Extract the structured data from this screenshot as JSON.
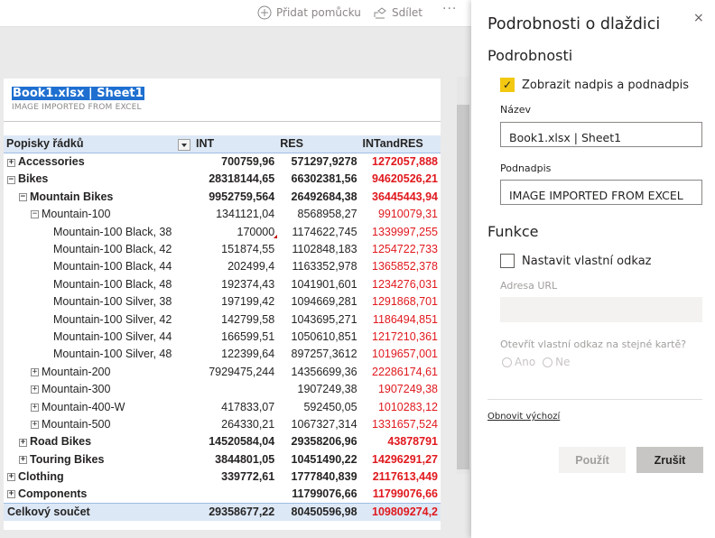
{
  "toolbar": {
    "add_widget": "Přidat pomůcku",
    "share": "Sdílet",
    "more": "···"
  },
  "tile": {
    "title": "Book1.xlsx | Sheet1",
    "subtitle": "IMAGE IMPORTED FROM EXCEL"
  },
  "pivot": {
    "headers": [
      "Popisky řádků",
      "INT",
      "RES",
      "INTandRES"
    ],
    "rows": [
      {
        "label": "Accessories",
        "int": "700759,96",
        "res": "571297,9278",
        "intres": "1272057,888"
      },
      {
        "label": "Bikes",
        "int": "28318144,65",
        "res": "66302381,56",
        "intres": "94620526,21"
      },
      {
        "label": "Mountain Bikes",
        "int": "9952759,564",
        "res": "26492684,38",
        "intres": "36445443,94"
      },
      {
        "label": "Mountain-100",
        "int": "1341121,04",
        "res": "8568958,27",
        "intres": "9910079,31"
      },
      {
        "label": "Mountain-100 Black, 38",
        "int": "170000",
        "res": "1174622,745",
        "intres": "1339997,255"
      },
      {
        "label": "Mountain-100 Black, 42",
        "int": "151874,55",
        "res": "1102848,183",
        "intres": "1254722,733"
      },
      {
        "label": "Mountain-100 Black, 44",
        "int": "202499,4",
        "res": "1163352,978",
        "intres": "1365852,378"
      },
      {
        "label": "Mountain-100 Black, 48",
        "int": "192374,43",
        "res": "1041901,601",
        "intres": "1234276,031"
      },
      {
        "label": "Mountain-100 Silver, 38",
        "int": "197199,42",
        "res": "1094669,281",
        "intres": "1291868,701"
      },
      {
        "label": "Mountain-100 Silver, 42",
        "int": "142799,58",
        "res": "1043695,271",
        "intres": "1186494,851"
      },
      {
        "label": "Mountain-100 Silver, 44",
        "int": "166599,51",
        "res": "1050610,851",
        "intres": "1217210,361"
      },
      {
        "label": "Mountain-100 Silver, 48",
        "int": "122399,64",
        "res": "897257,3612",
        "intres": "1019657,001"
      },
      {
        "label": "Mountain-200",
        "int": "7929475,244",
        "res": "14356699,36",
        "intres": "22286174,61"
      },
      {
        "label": "Mountain-300",
        "int": "",
        "res": "1907249,38",
        "intres": "1907249,38"
      },
      {
        "label": "Mountain-400-W",
        "int": "417833,07",
        "res": "592450,05",
        "intres": "1010283,12"
      },
      {
        "label": "Mountain-500",
        "int": "264330,21",
        "res": "1067327,314",
        "intres": "1331657,524"
      },
      {
        "label": "Road Bikes",
        "int": "14520584,04",
        "res": "29358206,96",
        "intres": "43878791"
      },
      {
        "label": "Touring Bikes",
        "int": "3844801,05",
        "res": "10451490,22",
        "intres": "14296291,27"
      },
      {
        "label": "Clothing",
        "int": "339772,61",
        "res": "1777840,839",
        "intres": "2117613,449"
      },
      {
        "label": "Components",
        "int": "",
        "res": "11799076,66",
        "intres": "11799076,66"
      }
    ],
    "total": {
      "label": "Celkový součet",
      "int": "29358677,22",
      "res": "80450596,98",
      "intres": "109809274,2"
    }
  },
  "pane": {
    "title": "Podrobnosti o dlaždici",
    "close": "×",
    "details_heading": "Podrobnosti",
    "show_title_label": "Zobrazit nadpis a podnadpis",
    "show_title_checked": true,
    "name_label": "Název",
    "name_value": "Book1.xlsx | Sheet1",
    "subtitle_label": "Podnadpis",
    "subtitle_value": "IMAGE IMPORTED FROM EXCEL",
    "functions_heading": "Funkce",
    "custom_link_label": "Nastavit vlastní odkaz",
    "custom_link_checked": false,
    "url_label": "Adresa URL",
    "url_value": "",
    "same_tab_question": "Otevřít vlastní odkaz na stejné kartě?",
    "yes": "Ano",
    "no": "Ne",
    "reset_link": "Obnovit výchozí",
    "apply": "Použít",
    "cancel": "Zrušit"
  },
  "colors": {
    "accent_yellow": "#f2c811",
    "negative_red": "#e0191e",
    "header_blue": "#dde8f6",
    "selection_blue": "#1e6fd0"
  }
}
